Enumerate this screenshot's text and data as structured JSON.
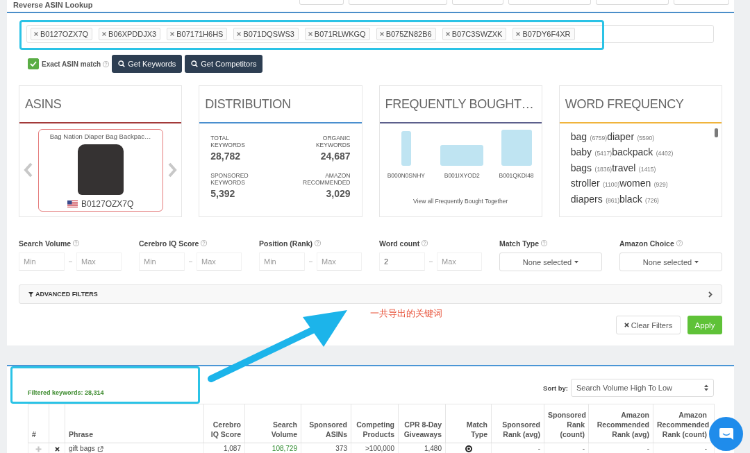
{
  "page": {
    "title": "Reverse ASIN Lookup"
  },
  "asin_input": {
    "tags": [
      "B0127OZX7Q",
      "B06XPDDJX3",
      "B07171H6HS",
      "B071DQSWS3",
      "B071RLWKGQ",
      "B075ZN82B6",
      "B07C3SWZXK",
      "B07DY6F4XR"
    ]
  },
  "exact_match": {
    "label": "Exact ASIN match",
    "checked": true
  },
  "actions": [
    {
      "label": "Get Keywords"
    },
    {
      "label": "Get Competitors"
    }
  ],
  "cards": [
    {
      "kind": "asins",
      "title": "ASINS",
      "color": "#a33a3a",
      "product": {
        "title": "Bag Nation Diaper Bag Backpac…",
        "asin": "B0127OZX7Q"
      }
    },
    {
      "kind": "distribution",
      "title": "DISTRIBUTION",
      "color": "#4a8fcf",
      "stats": [
        {
          "label": "TOTAL KEYWORDS",
          "value": "28,782"
        },
        {
          "label": "ORGANIC KEYWORDS",
          "value": "24,687"
        },
        {
          "label": "SPONSORED KEYWORDS",
          "value": "5,392"
        },
        {
          "label": "AMAZON RECOMMENDED",
          "value": "3,029"
        }
      ]
    },
    {
      "kind": "bought",
      "title": "FREQUENTLY BOUGHT…",
      "color": "#5c5f8c",
      "products": [
        {
          "asin": "B000N0SNHY"
        },
        {
          "asin": "B001IXYOD2"
        },
        {
          "asin": "B001QKDI48"
        }
      ],
      "link": "View all Frequently Bought Together"
    },
    {
      "kind": "words",
      "title": "WORD FREQUENCY",
      "color": "#f0b43c",
      "lines": [
        [
          {
            "word": "bag",
            "count": "(6759)"
          },
          {
            "word": "diaper",
            "count": "(5590)"
          }
        ],
        [
          {
            "word": "baby",
            "count": "(5417)"
          },
          {
            "word": "backpack",
            "count": "(4402)"
          }
        ],
        [
          {
            "word": "bags",
            "count": "(1836)"
          },
          {
            "word": "travel",
            "count": "(1415)"
          }
        ],
        [
          {
            "word": "stroller",
            "count": "(1100)"
          },
          {
            "word": "women",
            "count": "(929)"
          }
        ],
        [
          {
            "word": "diapers",
            "count": "(861)"
          },
          {
            "word": "black",
            "count": "(726)"
          }
        ]
      ]
    }
  ],
  "filters": [
    {
      "kind": "range",
      "label": "Search Volume",
      "min": {
        "placeholder": "Min"
      },
      "max": {
        "placeholder": "Max"
      }
    },
    {
      "kind": "range",
      "label": "Cerebro IQ Score",
      "min": {
        "placeholder": "Min"
      },
      "max": {
        "placeholder": "Max"
      }
    },
    {
      "kind": "range",
      "label": "Position (Rank)",
      "min": {
        "placeholder": "Min"
      },
      "max": {
        "placeholder": "Max"
      }
    },
    {
      "kind": "range",
      "label": "Word count",
      "min": {
        "value": "2"
      },
      "max": {
        "placeholder": "Max"
      }
    },
    {
      "kind": "select",
      "label": "Match Type",
      "value": "None selected"
    },
    {
      "kind": "select",
      "label": "Amazon Choice",
      "value": "None selected"
    }
  ],
  "advanced_filters": {
    "label": "ADVANCED FILTERS",
    "expanded": false
  },
  "annotation": {
    "text": "一共导出的关键词"
  },
  "filter_buttons": [
    {
      "kind": "clear",
      "label": "Clear Filters"
    },
    {
      "kind": "apply",
      "label": "Apply"
    }
  ],
  "results": {
    "count": "Filtered keywords: 28,314",
    "sort_label": "Sort by:",
    "sort_value": "Search Volume High To Low"
  },
  "table": {
    "columns": [
      {
        "kind": "index",
        "label": "#"
      },
      {
        "kind": "actions"
      },
      {
        "kind": "phrase",
        "label": "Phrase"
      },
      {
        "kind": "number",
        "label": "Cerebro IQ Score"
      },
      {
        "kind": "link",
        "label": "Search Volume"
      },
      {
        "kind": "number",
        "label": "Sponsored ASINs"
      },
      {
        "kind": "number",
        "label": "Competing Products"
      },
      {
        "kind": "number",
        "label": "CPR 8-Day Giveaways"
      },
      {
        "kind": "match",
        "label": "Match Type"
      },
      {
        "kind": "number",
        "label": "Sponsored Rank (avg)"
      },
      {
        "kind": "number",
        "label": "Sponsored Rank (count)"
      },
      {
        "kind": "number",
        "label": "Amazon Recommended Rank (avg)"
      },
      {
        "kind": "number",
        "label": "Amazon Recommended Rank (count)"
      }
    ],
    "rows": [
      {
        "phrase": "gift bags",
        "numbers": [
          "1,087",
          "108,729",
          "373",
          ">100,000",
          "1,480",
          "-",
          "-",
          "-",
          "-"
        ],
        "match": {
          "kind": "organic"
        }
      }
    ]
  }
}
